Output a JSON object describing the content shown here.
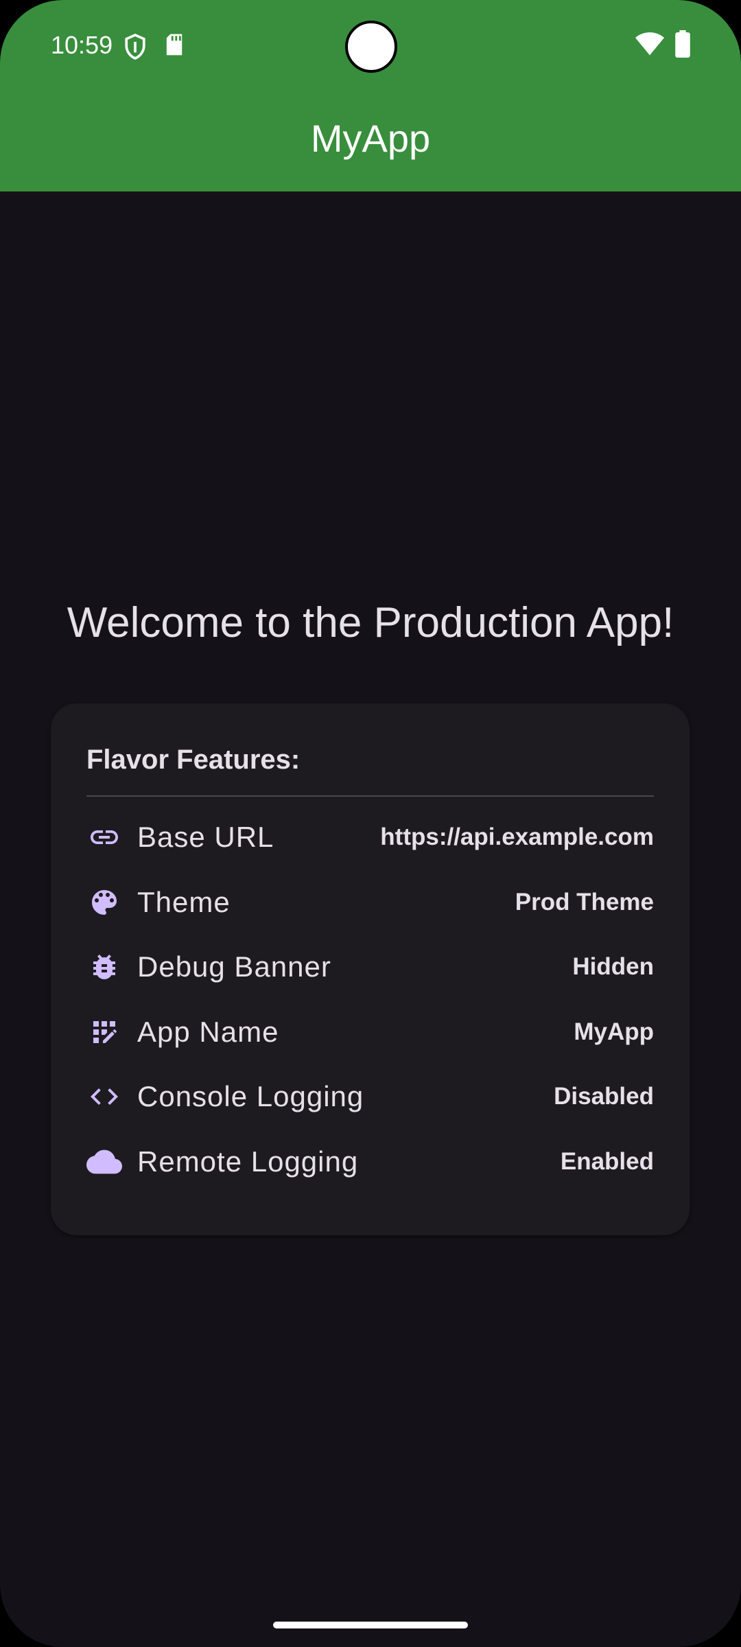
{
  "status_bar": {
    "time": "10:59",
    "icons": [
      "shield-icon",
      "sd-card-icon",
      "wifi-icon",
      "battery-icon"
    ]
  },
  "app_bar": {
    "title": "MyApp",
    "color": "#388e3c"
  },
  "main": {
    "welcome_text": "Welcome to the Production App!"
  },
  "card": {
    "title": "Flavor Features:",
    "accent_color": "#d0bcff",
    "rows": [
      {
        "icon": "link-icon",
        "label": "Base URL",
        "value": "https://api.example.com"
      },
      {
        "icon": "palette-icon",
        "label": "Theme",
        "value": "Prod Theme"
      },
      {
        "icon": "bug-icon",
        "label": "Debug Banner",
        "value": "Hidden"
      },
      {
        "icon": "app-registration-icon",
        "label": "App Name",
        "value": "MyApp"
      },
      {
        "icon": "code-icon",
        "label": "Console Logging",
        "value": "Disabled"
      },
      {
        "icon": "cloud-icon",
        "label": "Remote Logging",
        "value": "Enabled"
      }
    ]
  }
}
